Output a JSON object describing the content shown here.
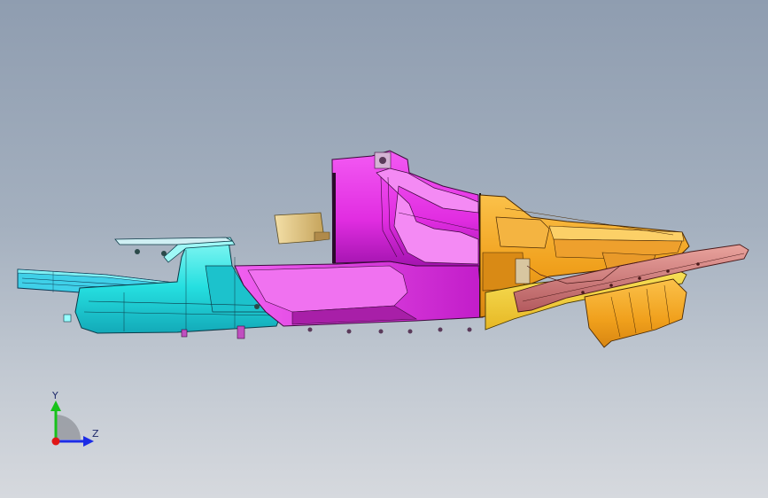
{
  "viewport": {
    "background_top": "#8f9db0",
    "background_bottom": "#d6d9de"
  },
  "model": {
    "parts": [
      {
        "name": "rear-frame",
        "color": "#2fe3e3"
      },
      {
        "name": "center-tub",
        "color": "#e82ce8"
      },
      {
        "name": "front-frame",
        "color": "#f2a21b"
      },
      {
        "name": "front-floor-panel",
        "color": "#f5d23a"
      },
      {
        "name": "side-rail",
        "color": "#d47d7a"
      },
      {
        "name": "bracket",
        "color": "#e8c97f"
      }
    ]
  },
  "triad": {
    "y_label": "Y",
    "z_label": "Z",
    "y_color": "#17c21a",
    "z_color": "#1c2ce6",
    "x_color": "#e01616"
  }
}
